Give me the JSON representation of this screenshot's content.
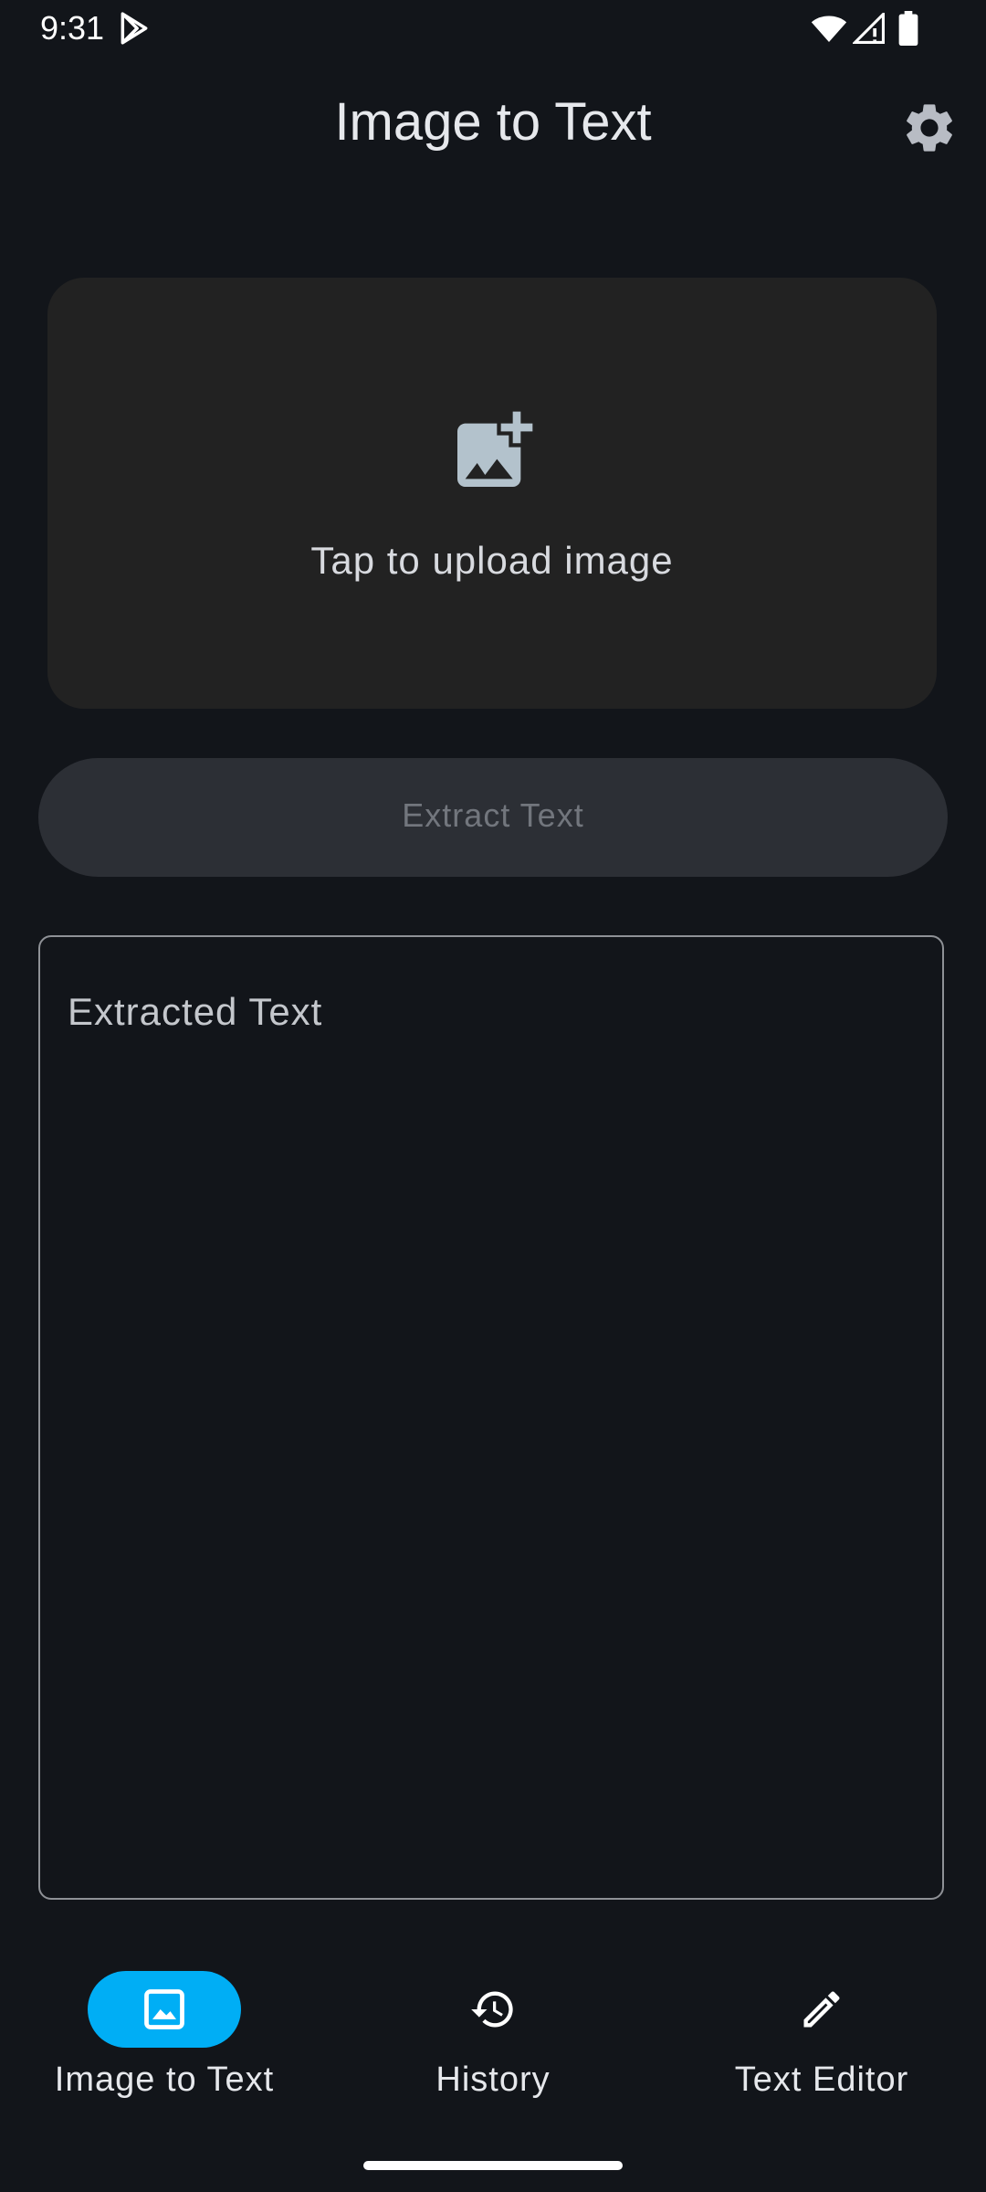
{
  "status_bar": {
    "time": "9:31"
  },
  "app_bar": {
    "title": "Image to Text",
    "settings_icon": "gear-icon"
  },
  "upload": {
    "label": "Tap to upload image",
    "icon": "add-photo-icon"
  },
  "extract_button": {
    "label": "Extract Text",
    "enabled": false
  },
  "extracted_field": {
    "label": "Extracted Text",
    "value": ""
  },
  "bottom_nav": {
    "items": [
      {
        "label": "Image to Text",
        "icon": "image-icon",
        "active": true
      },
      {
        "label": "History",
        "icon": "history-icon",
        "active": false
      },
      {
        "label": "Text Editor",
        "icon": "pencil-icon",
        "active": false
      }
    ]
  },
  "colors": {
    "background": "#12151a",
    "card": "#222222",
    "button_disabled": "#2c2f35",
    "accent": "#00aef5",
    "outline": "#8e9196"
  }
}
